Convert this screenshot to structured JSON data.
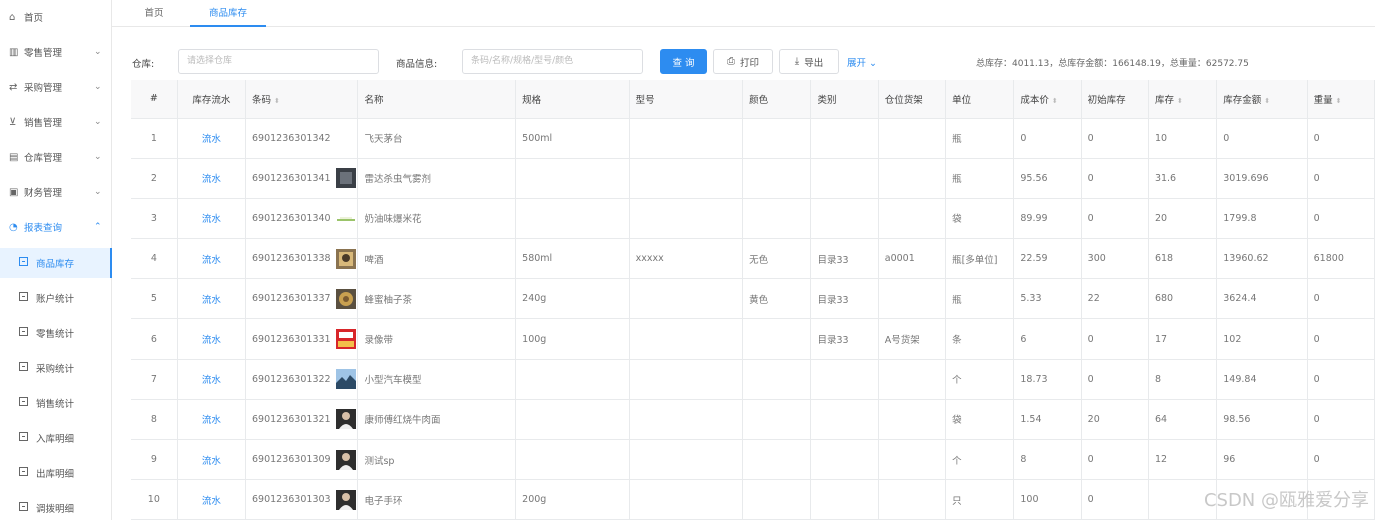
{
  "sidebar": {
    "items": [
      {
        "label": "首页",
        "icon": "home-icon",
        "glyph": "⌂",
        "chevron": ""
      },
      {
        "label": "零售管理",
        "icon": "store-icon",
        "glyph": "▥",
        "chevron": "⌄"
      },
      {
        "label": "采购管理",
        "icon": "purchase-icon",
        "glyph": "⇄",
        "chevron": "⌄"
      },
      {
        "label": "销售管理",
        "icon": "cart-icon",
        "glyph": "⊻",
        "chevron": "⌄"
      },
      {
        "label": "仓库管理",
        "icon": "warehouse-icon",
        "glyph": "▤",
        "chevron": "⌄"
      },
      {
        "label": "财务管理",
        "icon": "finance-icon",
        "glyph": "▣",
        "chevron": "⌄"
      },
      {
        "label": "报表查询",
        "icon": "report-icon",
        "glyph": "◔",
        "chevron": "⌃"
      }
    ],
    "subitems": [
      {
        "label": "商品库存"
      },
      {
        "label": "账户统计"
      },
      {
        "label": "零售统计"
      },
      {
        "label": "采购统计"
      },
      {
        "label": "销售统计"
      },
      {
        "label": "入库明细"
      },
      {
        "label": "出库明细"
      },
      {
        "label": "调拨明细"
      }
    ]
  },
  "tabs": [
    {
      "label": "首页"
    },
    {
      "label": "商品库存"
    }
  ],
  "toolbar": {
    "warehouse_label": "仓库:",
    "warehouse_placeholder": "请选择仓库",
    "product_label": "商品信息:",
    "product_placeholder": "条码/名称/规格/型号/颜色",
    "query_label": "查 询",
    "print_label": "打印",
    "export_label": "导出",
    "expand_label": "展开",
    "totals": "总库存：4011.13，总库存金额：166148.19，总重量：62572.75"
  },
  "colors": {
    "accent": "#2d8cf0"
  },
  "table": {
    "headers": [
      "#",
      "库存流水",
      "条码",
      "名称",
      "规格",
      "型号",
      "颜色",
      "类别",
      "仓位货架",
      "单位",
      "成本价",
      "初始库存",
      "库存",
      "库存金额",
      "重量"
    ],
    "rows": [
      {
        "idx": "1",
        "flow": "流水",
        "barcode": "6901236301342",
        "thumb": "",
        "name": "飞天茅台",
        "spec": "500ml",
        "model": "",
        "color": "",
        "category": "",
        "shelf": "",
        "unit": "瓶",
        "cost": "0",
        "init": "0",
        "stock": "10",
        "amount": "0",
        "weight": "0"
      },
      {
        "idx": "2",
        "flow": "流水",
        "barcode": "6901236301341",
        "thumb": "dark",
        "name": "雷达杀虫气雾剂",
        "spec": "",
        "model": "",
        "color": "",
        "category": "",
        "shelf": "",
        "unit": "瓶",
        "cost": "95.56",
        "init": "0",
        "stock": "31.6",
        "amount": "3019.696",
        "weight": "0"
      },
      {
        "idx": "3",
        "flow": "流水",
        "barcode": "6901236301340",
        "thumb": "line",
        "name": "奶油味爆米花",
        "spec": "",
        "model": "",
        "color": "",
        "category": "",
        "shelf": "",
        "unit": "袋",
        "cost": "89.99",
        "init": "0",
        "stock": "20",
        "amount": "1799.8",
        "weight": "0"
      },
      {
        "idx": "4",
        "flow": "流水",
        "barcode": "6901236301338",
        "thumb": "photo",
        "name": "啤酒",
        "spec": "580ml",
        "model": "xxxxx",
        "color": "无色",
        "category": "目录33",
        "shelf": "a0001",
        "unit": "瓶[多单位]",
        "cost": "22.59",
        "init": "300",
        "stock": "618",
        "amount": "13960.62",
        "weight": "61800"
      },
      {
        "idx": "5",
        "flow": "流水",
        "barcode": "6901236301337",
        "thumb": "round",
        "name": "蜂蜜柚子茶",
        "spec": "240g",
        "model": "",
        "color": "黄色",
        "category": "目录33",
        "shelf": "",
        "unit": "瓶",
        "cost": "5.33",
        "init": "22",
        "stock": "680",
        "amount": "3624.4",
        "weight": "0"
      },
      {
        "idx": "6",
        "flow": "流水",
        "barcode": "6901236301331",
        "thumb": "red",
        "name": "录像带",
        "spec": "100g",
        "model": "",
        "color": "",
        "category": "目录33",
        "shelf": "A号货架",
        "unit": "条",
        "cost": "6",
        "init": "0",
        "stock": "17",
        "amount": "102",
        "weight": "0"
      },
      {
        "idx": "7",
        "flow": "流水",
        "barcode": "6901236301322",
        "thumb": "sky",
        "name": "小型汽车模型",
        "spec": "",
        "model": "",
        "color": "",
        "category": "",
        "shelf": "",
        "unit": "个",
        "cost": "18.73",
        "init": "0",
        "stock": "8",
        "amount": "149.84",
        "weight": "0"
      },
      {
        "idx": "8",
        "flow": "流水",
        "barcode": "6901236301321",
        "thumb": "person",
        "name": "康师傅红烧牛肉面",
        "spec": "",
        "model": "",
        "color": "",
        "category": "",
        "shelf": "",
        "unit": "袋",
        "cost": "1.54",
        "init": "20",
        "stock": "64",
        "amount": "98.56",
        "weight": "0"
      },
      {
        "idx": "9",
        "flow": "流水",
        "barcode": "6901236301309",
        "thumb": "person",
        "name": "测试sp",
        "spec": "",
        "model": "",
        "color": "",
        "category": "",
        "shelf": "",
        "unit": "个",
        "cost": "8",
        "init": "0",
        "stock": "12",
        "amount": "96",
        "weight": "0"
      },
      {
        "idx": "10",
        "flow": "流水",
        "barcode": "6901236301303",
        "thumb": "person",
        "name": "电子手环",
        "spec": "200g",
        "model": "",
        "color": "",
        "category": "",
        "shelf": "",
        "unit": "只",
        "cost": "100",
        "init": "0",
        "stock": "",
        "amount": "",
        "weight": ""
      }
    ]
  },
  "watermark": "CSDN @瓯雅爱分享"
}
